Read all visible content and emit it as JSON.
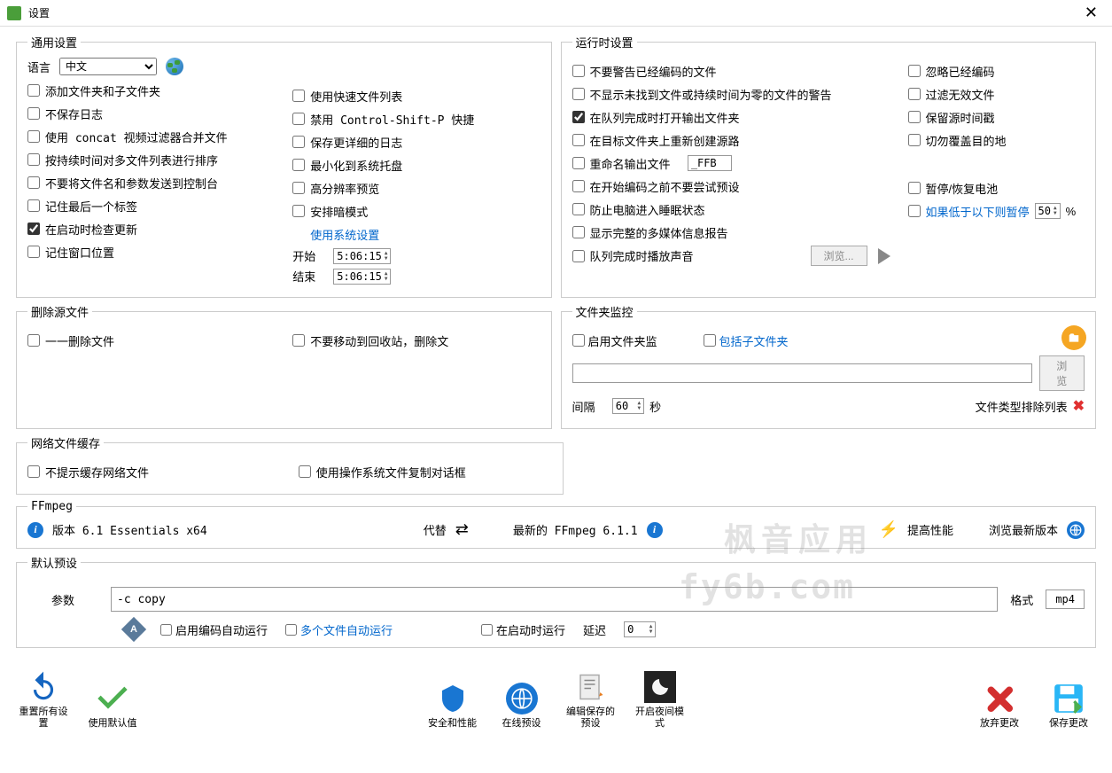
{
  "window": {
    "title": "设置"
  },
  "general": {
    "legend": "通用设置",
    "lang_label": "语言",
    "lang_value": "中文",
    "left": [
      "添加文件夹和子文件夹",
      "不保存日志",
      "使用 concat 视频过滤器合并文件",
      "按持续时间对多文件列表进行排序",
      "不要将文件名和参数发送到控制台",
      "记住最后一个标签",
      "在启动时检查更新",
      "记住窗口位置"
    ],
    "left_checked": [
      false,
      false,
      false,
      false,
      false,
      false,
      true,
      false
    ],
    "right": [
      "使用快速文件列表",
      "禁用 Control-Shift-P 快捷",
      "保存更详细的日志",
      "最小化到系统托盘",
      "高分辨率预览",
      "安排暗模式"
    ],
    "right_link": "使用系统设置",
    "start_label": "开始",
    "end_label": "结束",
    "start_time": "5:06:15",
    "end_time": "5:06:15"
  },
  "runtime": {
    "legend": "运行时设置",
    "left": [
      "不要警告已经编码的文件",
      "不显示未找到文件或持续时间为零的文件的警告",
      "在队列完成时打开输出文件夹",
      "在目标文件夹上重新创建源路",
      "重命名输出文件",
      "在开始编码之前不要尝试预设",
      "防止电脑进入睡眠状态",
      "显示完整的多媒体信息报告",
      "队列完成时播放声音"
    ],
    "left_checked": [
      false,
      false,
      true,
      false,
      false,
      false,
      false,
      false,
      false
    ],
    "rename_suffix": "_FFB",
    "right": [
      "忽略已经编码",
      "过滤无效文件",
      "保留源时间戳",
      "切勿覆盖目的地"
    ],
    "pause_label": "暂停/恢复电池",
    "pause_below": "如果低于以下则暂停",
    "pause_pct": "50",
    "pct_sign": "%",
    "browse": "浏览..."
  },
  "delete_src": {
    "legend": "删除源文件",
    "opt1": "一一删除文件",
    "opt2": "不要移动到回收站，删除文"
  },
  "folder_monitor": {
    "legend": "文件夹监控",
    "enable": "启用文件夹监",
    "subfolder": "包括子文件夹",
    "browse": "浏览",
    "interval_label": "间隔",
    "interval_val": "60",
    "seconds": "秒",
    "exclude": "文件类型排除列表"
  },
  "net_cache": {
    "legend": "网络文件缓存",
    "opt1": "不提示缓存网络文件",
    "opt2": "使用操作系统文件复制对话框"
  },
  "ffmpeg": {
    "legend": "FFmpeg",
    "version": "版本 6.1 Essentials  x64",
    "replace": "代替",
    "latest": "最新的 FFmpeg 6.1.1",
    "boost": "提高性能",
    "browse_new": "浏览最新版本"
  },
  "preset": {
    "legend": "默认预设",
    "param_label": "参数",
    "param_value": "-c copy",
    "format_label": "格式",
    "format_value": "mp4",
    "auto_encode": "启用编码自动运行",
    "multi_auto": "多个文件自动运行",
    "run_start": "在启动时运行",
    "delay_label": "延迟",
    "delay_val": "0"
  },
  "toolbar": {
    "reset": "重置所有设置",
    "defaults": "使用默认值",
    "security": "安全和性能",
    "online": "在线预设",
    "edit_saved": "编辑保存的预设",
    "night": "开启夜间模式",
    "discard": "放弃更改",
    "save": "保存更改"
  },
  "watermark": {
    "line1": "枫音应用",
    "line2": "fy6b.com"
  }
}
